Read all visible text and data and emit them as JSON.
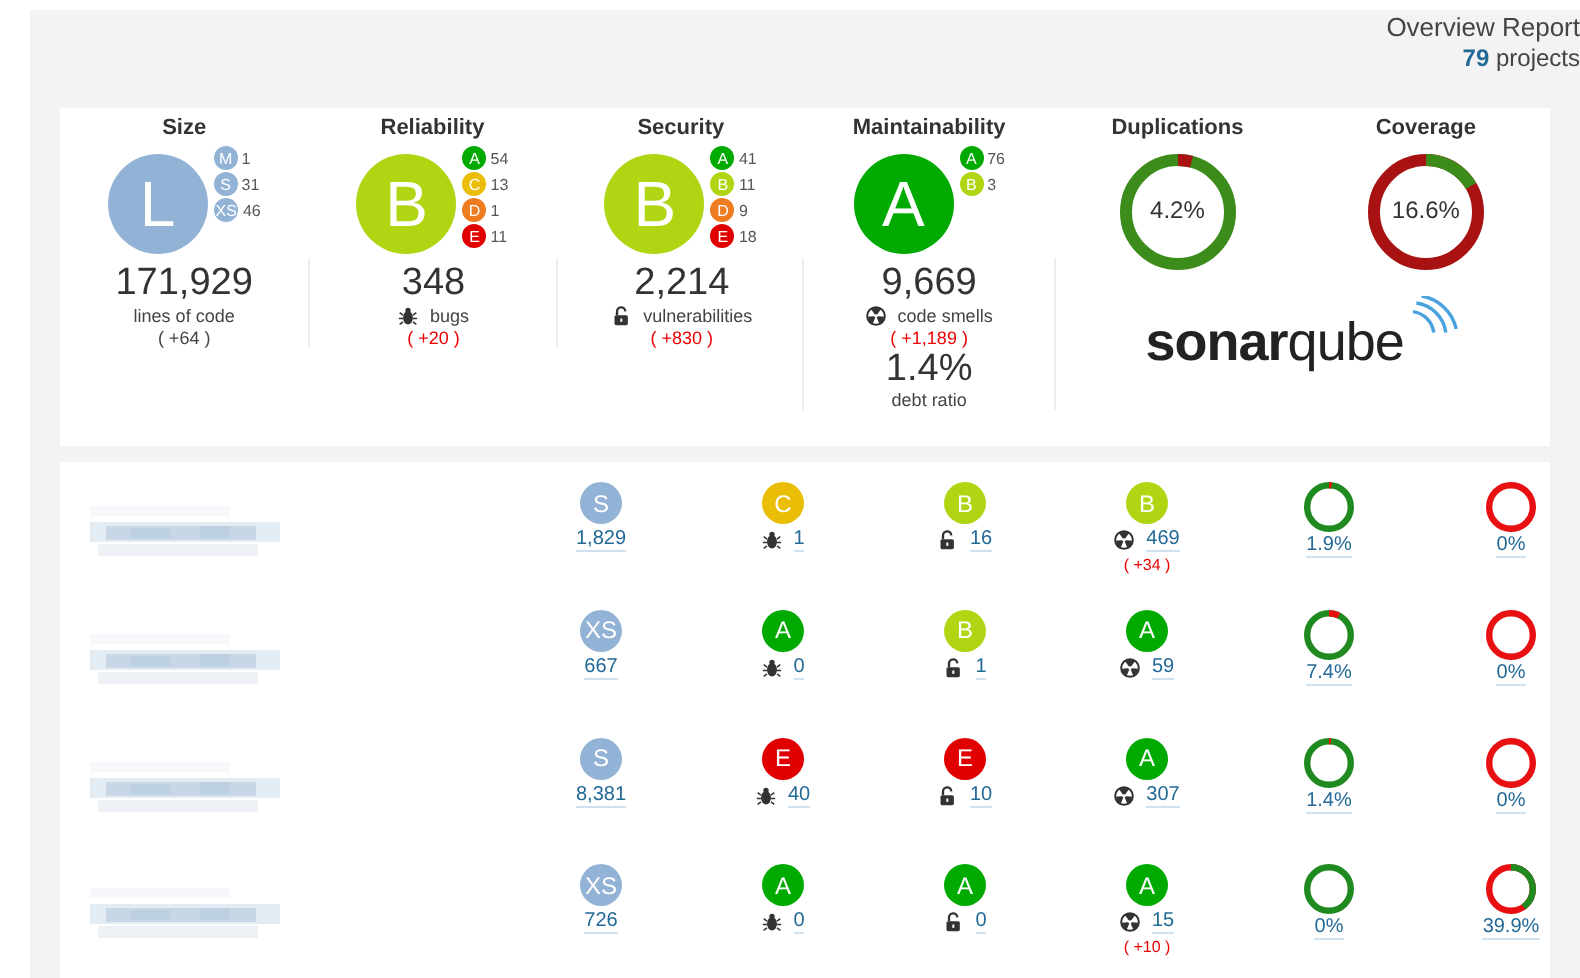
{
  "header": {
    "title": "Overview Report",
    "projects": "**79** projects"
  },
  "summary": [
    {
      "kind": "rating",
      "title": "Size",
      "rating": "L",
      "color": "#93b3d6",
      "distribution": [
        {
          "label": "M",
          "count": "1",
          "color": "#93b3d6"
        },
        {
          "label": "S",
          "count": "31",
          "color": "#93b3d6"
        },
        {
          "label": "XS",
          "count": "46",
          "color": "#93b3d6"
        }
      ],
      "value": "171,929",
      "caption": "lines of code",
      "delta": "( +64 )",
      "worse": false
    },
    {
      "kind": "rating",
      "title": "Reliability",
      "rating": "B",
      "color": "#b0d513",
      "distribution": [
        {
          "label": "A",
          "count": "54",
          "color": "#00aa00"
        },
        {
          "label": "C",
          "count": "13",
          "color": "#eabe06"
        },
        {
          "label": "D",
          "count": "1",
          "color": "#ed7d20"
        },
        {
          "label": "E",
          "count": "11",
          "color": "#e00000"
        }
      ],
      "value": "348",
      "caption": "bugs",
      "delta": "( +20 )",
      "worse": true
    },
    {
      "kind": "rating",
      "title": "Security",
      "rating": "B",
      "color": "#b0d513",
      "distribution": [
        {
          "label": "A",
          "count": "41",
          "color": "#00aa00"
        },
        {
          "label": "B",
          "count": "11",
          "color": "#b0d513"
        },
        {
          "label": "D",
          "count": "9",
          "color": "#ed7d20"
        },
        {
          "label": "E",
          "count": "18",
          "color": "#e00000"
        }
      ],
      "value": "2,214",
      "caption": "vulnerabilities",
      "delta": "( +830 )",
      "worse": true
    },
    {
      "kind": "rating",
      "title": "Maintainability",
      "rating": "A",
      "color": "#00aa00",
      "distribution": [
        {
          "label": "A",
          "count": "76",
          "color": "#00aa00"
        },
        {
          "label": "B",
          "count": "3",
          "color": "#b0d513"
        }
      ],
      "value": "9,669",
      "caption": "code smells",
      "delta": "( +1,189 )",
      "worse": true,
      "extra_value": "1.4%",
      "extra_caption": "debt ratio"
    },
    {
      "kind": "donut",
      "title": "Duplications",
      "reading": "4.2%"
    },
    {
      "kind": "donut",
      "title": "Coverage",
      "reading": "16.6%"
    }
  ],
  "logo": "**sonar**qube",
  "projects": [
    {
      "size": {
        "rating": "S",
        "color": "#93b3d6",
        "value": "1,829"
      },
      "reliability": {
        "rating": "C",
        "color": "#eabe06",
        "value": "1"
      },
      "security": {
        "rating": "B",
        "color": "#b0d513",
        "value": "16"
      },
      "maintainability": {
        "rating": "B",
        "color": "#b0d513",
        "value": "469",
        "delta": "( +34 )"
      },
      "duplications": {
        "reading": "1.9%"
      },
      "coverage": {
        "reading": "0%"
      }
    },
    {
      "size": {
        "rating": "XS",
        "color": "#93b3d6",
        "value": "667"
      },
      "reliability": {
        "rating": "A",
        "color": "#00aa00",
        "value": "0"
      },
      "security": {
        "rating": "B",
        "color": "#b0d513",
        "value": "1"
      },
      "maintainability": {
        "rating": "A",
        "color": "#00aa00",
        "value": "59"
      },
      "duplications": {
        "reading": "7.4%"
      },
      "coverage": {
        "reading": "0%"
      }
    },
    {
      "size": {
        "rating": "S",
        "color": "#93b3d6",
        "value": "8,381"
      },
      "reliability": {
        "rating": "E",
        "color": "#e00000",
        "value": "40"
      },
      "security": {
        "rating": "E",
        "color": "#e00000",
        "value": "10"
      },
      "maintainability": {
        "rating": "A",
        "color": "#00aa00",
        "value": "307"
      },
      "duplications": {
        "reading": "1.4%"
      },
      "coverage": {
        "reading": "0%"
      }
    },
    {
      "size": {
        "rating": "XS",
        "color": "#93b3d6",
        "value": "726"
      },
      "reliability": {
        "rating": "A",
        "color": "#00aa00",
        "value": "0"
      },
      "security": {
        "rating": "A",
        "color": "#00aa00",
        "value": "0"
      },
      "maintainability": {
        "rating": "A",
        "color": "#00aa00",
        "value": "15",
        "delta": "( +10 )"
      },
      "duplications": {
        "reading": "0%"
      },
      "coverage": {
        "reading": "39.9%"
      }
    }
  ]
}
